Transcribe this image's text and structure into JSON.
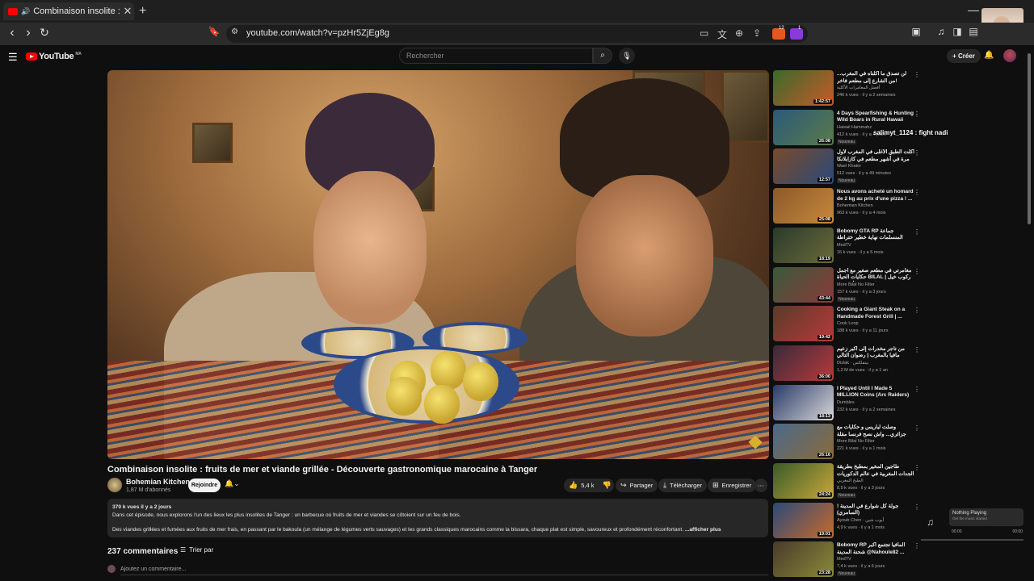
{
  "browser": {
    "tab_title": "Combinaison insolite : fruits de mer et viande grillée - Découverte gastronomique marocaine à Tanger",
    "close_glyph": "✕",
    "new_tab_glyph": "+",
    "url": "youtube.com/watch?v=pzHr5ZjEg8g",
    "brave_badge": "12",
    "rewards_badge": "1"
  },
  "youtube_header": {
    "logo_text": "YouTube",
    "logo_region": "MA",
    "search_placeholder": "Rechercher",
    "create_label": "+ Créer"
  },
  "video": {
    "title": "Combinaison insolite : fruits de mer et viande grillée - Découverte gastronomique marocaine à Tanger",
    "channel": "Bohemian Kitchen",
    "subscribers": "1,87 M d'abonnés",
    "join_label": "Rejoindre",
    "likes": "5,4 k",
    "share_label": "Partager",
    "download_label": "Télécharger",
    "save_label": "Enregistrer",
    "more_glyph": "⋯"
  },
  "description": {
    "meta": "370 k vues  il y a 2 jours",
    "line1": "Dans cet épisode, nous explorons l'un des lieux les plus insolites de Tanger : un barbecue où fruits de mer et viandes se côtoient sur un feu de bois.",
    "line2": "Des viandes grillées et fumées aux fruits de mer frais, en passant par le bakoula (un mélange de légumes verts sauvages) et les grands classiques marocains comme la bissara, chaque plat est simple, savoureux et profondément réconfortant.",
    "more": "...afficher plus"
  },
  "comments": {
    "count": "237 commentaires",
    "sort_label": "Trier par",
    "add_placeholder": "Ajoutez un commentaire..."
  },
  "chat_overlay": "salimyt_1124 : fight nadi",
  "recommendations": [
    {
      "title": "لن تصدق ما أكلناه في المغرب... من الشارع إلى مطعم فاخر!",
      "channel": "أفضل المغامرات الأكلية",
      "views": "246 k vues · il y a 2 semaines",
      "duration": "1:42:57",
      "badge": "",
      "colors": [
        "#3a6a2a",
        "#c85a2a"
      ]
    },
    {
      "title": "4 Days Spearfishing & Hunting Wild Boars in Rural Hawaii",
      "channel": "Hawaii Hammahz",
      "views": "412 k vues · il y a 4 jours",
      "duration": "26:08",
      "badge": "Nouveau",
      "colors": [
        "#2a5a7a",
        "#5a7a4a"
      ]
    },
    {
      "title": "أكلت الطبق الأغلى في المغرب لأول مرة في أشهر مطعم في كازابلانكا (الدار البيضاء)",
      "channel": "Wael Khater",
      "views": "512 vues · il y a 49 minutes",
      "duration": "12:57",
      "badge": "Nouveau",
      "colors": [
        "#7a4a2a",
        "#2a4a7a"
      ]
    },
    {
      "title": "Nous avons acheté un homard de 2 kg au prix d'une pizza ! ...",
      "channel": "Bohemian Kitchen",
      "views": "963 k vues · il y a 4 mois",
      "duration": "25:08",
      "badge": "",
      "colors": [
        "#8a5a2a",
        "#c8883a"
      ]
    },
    {
      "title": "Bobomy GTA RP جماعة المنسلمات نهاية خطير ختراطة",
      "channel": "MedTV",
      "views": "16 k vues · il y a 5 mois",
      "duration": "18:19",
      "badge": "",
      "colors": [
        "#2a3a2a",
        "#6a6a3a"
      ]
    },
    {
      "title": "مغامرتي في مطعم صغير مع أجمل حكايات الحياة BILAL | ركوب خيل الفروسية لأول مرة",
      "channel": "More Bilal No Filter",
      "views": "157 k vues · il y a 3 jours",
      "duration": "43:44",
      "badge": "Nouveau",
      "colors": [
        "#3a5a3a",
        "#8a3a3a"
      ]
    },
    {
      "title": "Cooking a Giant Steak on a Handmade Forest Grill | ...",
      "channel": "Cook Loop",
      "views": "188 k vues · il y a 11 jours",
      "duration": "19:42",
      "badge": "",
      "colors": [
        "#5a3a2a",
        "#b83a3a"
      ]
    },
    {
      "title": "من تاجر مخدرات إلى أكبر زعيم مافيا بالمغرب | رضوان التالي",
      "channel": "Dizlak · نيتفلكس",
      "views": "1,2 M de vues · il y a 1 an",
      "duration": "36:00",
      "badge": "",
      "colors": [
        "#3a2a3a",
        "#b83a3a"
      ]
    },
    {
      "title": "I Played Until I Made 5 MILLION Coins (Arc Raiders)",
      "channel": "Dumbles",
      "views": "232 k vues · il y a 2 semaines",
      "duration": "18:13",
      "badge": "",
      "colors": [
        "#2a3a6a",
        "#d8d8d8"
      ]
    },
    {
      "title": "وصلت لباريس و حكايات مع جزائري... واش نصح فرنسا مقلة فيها مقابلي!",
      "channel": "More Bilal No Filter",
      "views": "221 k vues · il y a 1 mois",
      "duration": "26:16",
      "badge": "",
      "colors": [
        "#4a6a8a",
        "#8a6a3a"
      ]
    },
    {
      "title": "طاجين المخير بمطبخ بطريقة الجدات المغربية في عالم الدكوريات !",
      "channel": "الطبخ المغربي",
      "views": "8,9 k vues · il y a 3 jours",
      "duration": "24:24",
      "badge": "Nouveau",
      "colors": [
        "#3a5a2a",
        "#c8a83a"
      ]
    },
    {
      "title": "جولة كل شوارع في المدينة !(السامري)",
      "channel": "Ayoub Chen · أيوب شين",
      "views": "4,9 k vues · il y a 1 mois",
      "duration": "19:01",
      "badge": "",
      "colors": [
        "#2a4a7a",
        "#c86a2a"
      ]
    },
    {
      "title": "Bobomy RP المافيا تجتمع أكبر شحنة المدينة @Nahoule82 ...",
      "channel": "MedTV",
      "views": "7,4 k vues · il y a 6 jours",
      "duration": "23:28",
      "badge": "Nouveau",
      "colors": [
        "#4a3a2a",
        "#8a8a3a"
      ]
    }
  ],
  "mini_player": {
    "title": "Nothing Playing",
    "subtitle": "Get the music started",
    "time_start": "00:00",
    "time_end": "00:00"
  }
}
